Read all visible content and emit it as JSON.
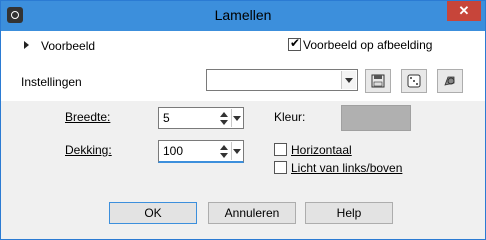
{
  "window": {
    "title": "Lamellen",
    "close_label": "✕"
  },
  "preview": {
    "label": "Voorbeeld",
    "checkbox_label": "Voorbeeld op afbeelding",
    "checkbox_checked": true
  },
  "settings": {
    "label": "Instellingen",
    "preset_value": ""
  },
  "fields": {
    "breedte": {
      "label": "Breedte:",
      "value": "5"
    },
    "dekking": {
      "label": "Dekking:",
      "value": "100"
    },
    "kleur": {
      "label": "Kleur:",
      "color": "#b0b0b0"
    }
  },
  "options": {
    "horizontaal": {
      "label": "Horizontaal",
      "checked": false
    },
    "licht": {
      "label": "Licht van links/boven",
      "checked": false
    }
  },
  "buttons": {
    "ok": "OK",
    "cancel": "Annuleren",
    "help": "Help"
  }
}
